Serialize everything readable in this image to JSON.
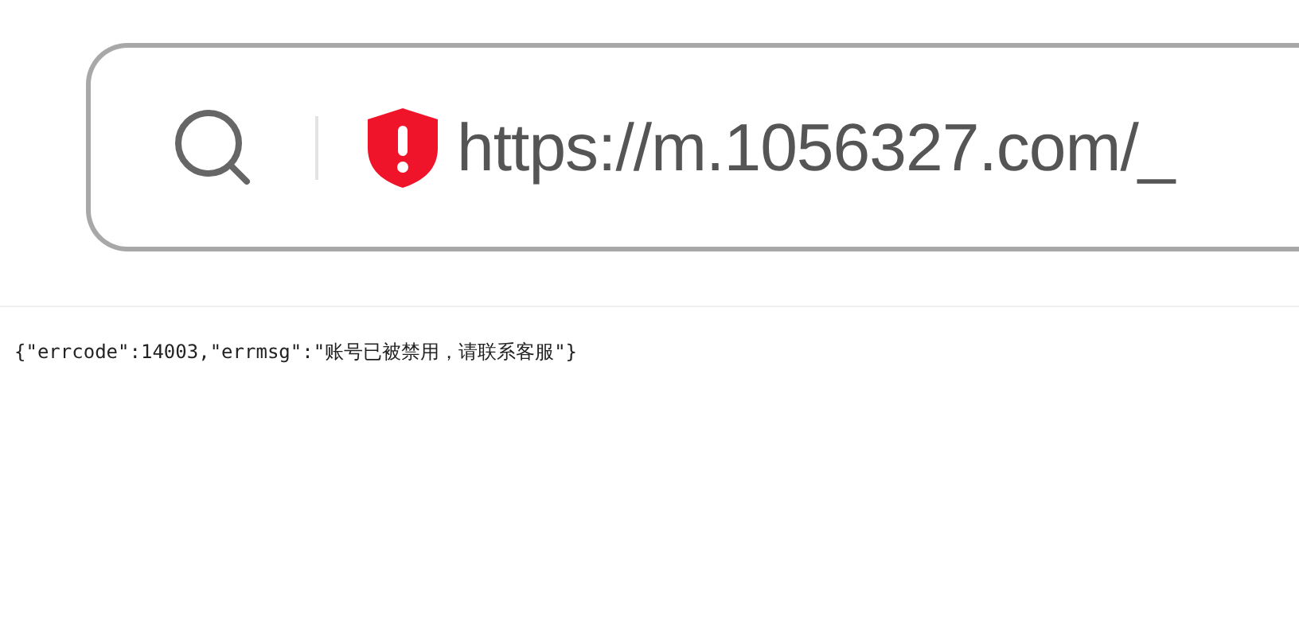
{
  "address_bar": {
    "url": "https://m.1056327.com/_"
  },
  "response": {
    "text": "{\"errcode\":14003,\"errmsg\":\"账号已被禁用，请联系客服\"}"
  }
}
